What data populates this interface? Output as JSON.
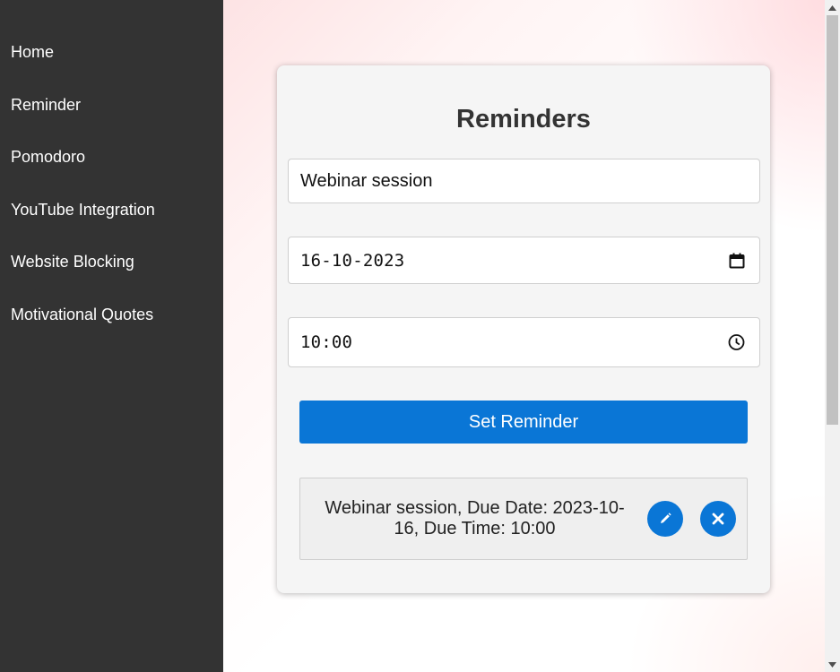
{
  "sidebar": {
    "items": [
      {
        "label": "Home"
      },
      {
        "label": "Reminder"
      },
      {
        "label": "Pomodoro"
      },
      {
        "label": "YouTube Integration"
      },
      {
        "label": "Website Blocking"
      },
      {
        "label": "Motivational Quotes"
      }
    ]
  },
  "reminders": {
    "title": "Reminders",
    "text_input_value": "Webinar session",
    "date_input_value": "16-10-2023",
    "time_input_value": "10:00",
    "submit_label": "Set Reminder",
    "list": [
      {
        "text": "Webinar session, Due Date: 2023-10-16, Due Time: 10:00"
      }
    ]
  },
  "icons": {
    "date": "calendar-icon",
    "time": "clock-icon",
    "edit": "pencil-icon",
    "delete": "close-icon"
  },
  "colors": {
    "sidebar_bg": "#333333",
    "accent": "#0a76d6",
    "card_bg": "#f5f5f5"
  }
}
